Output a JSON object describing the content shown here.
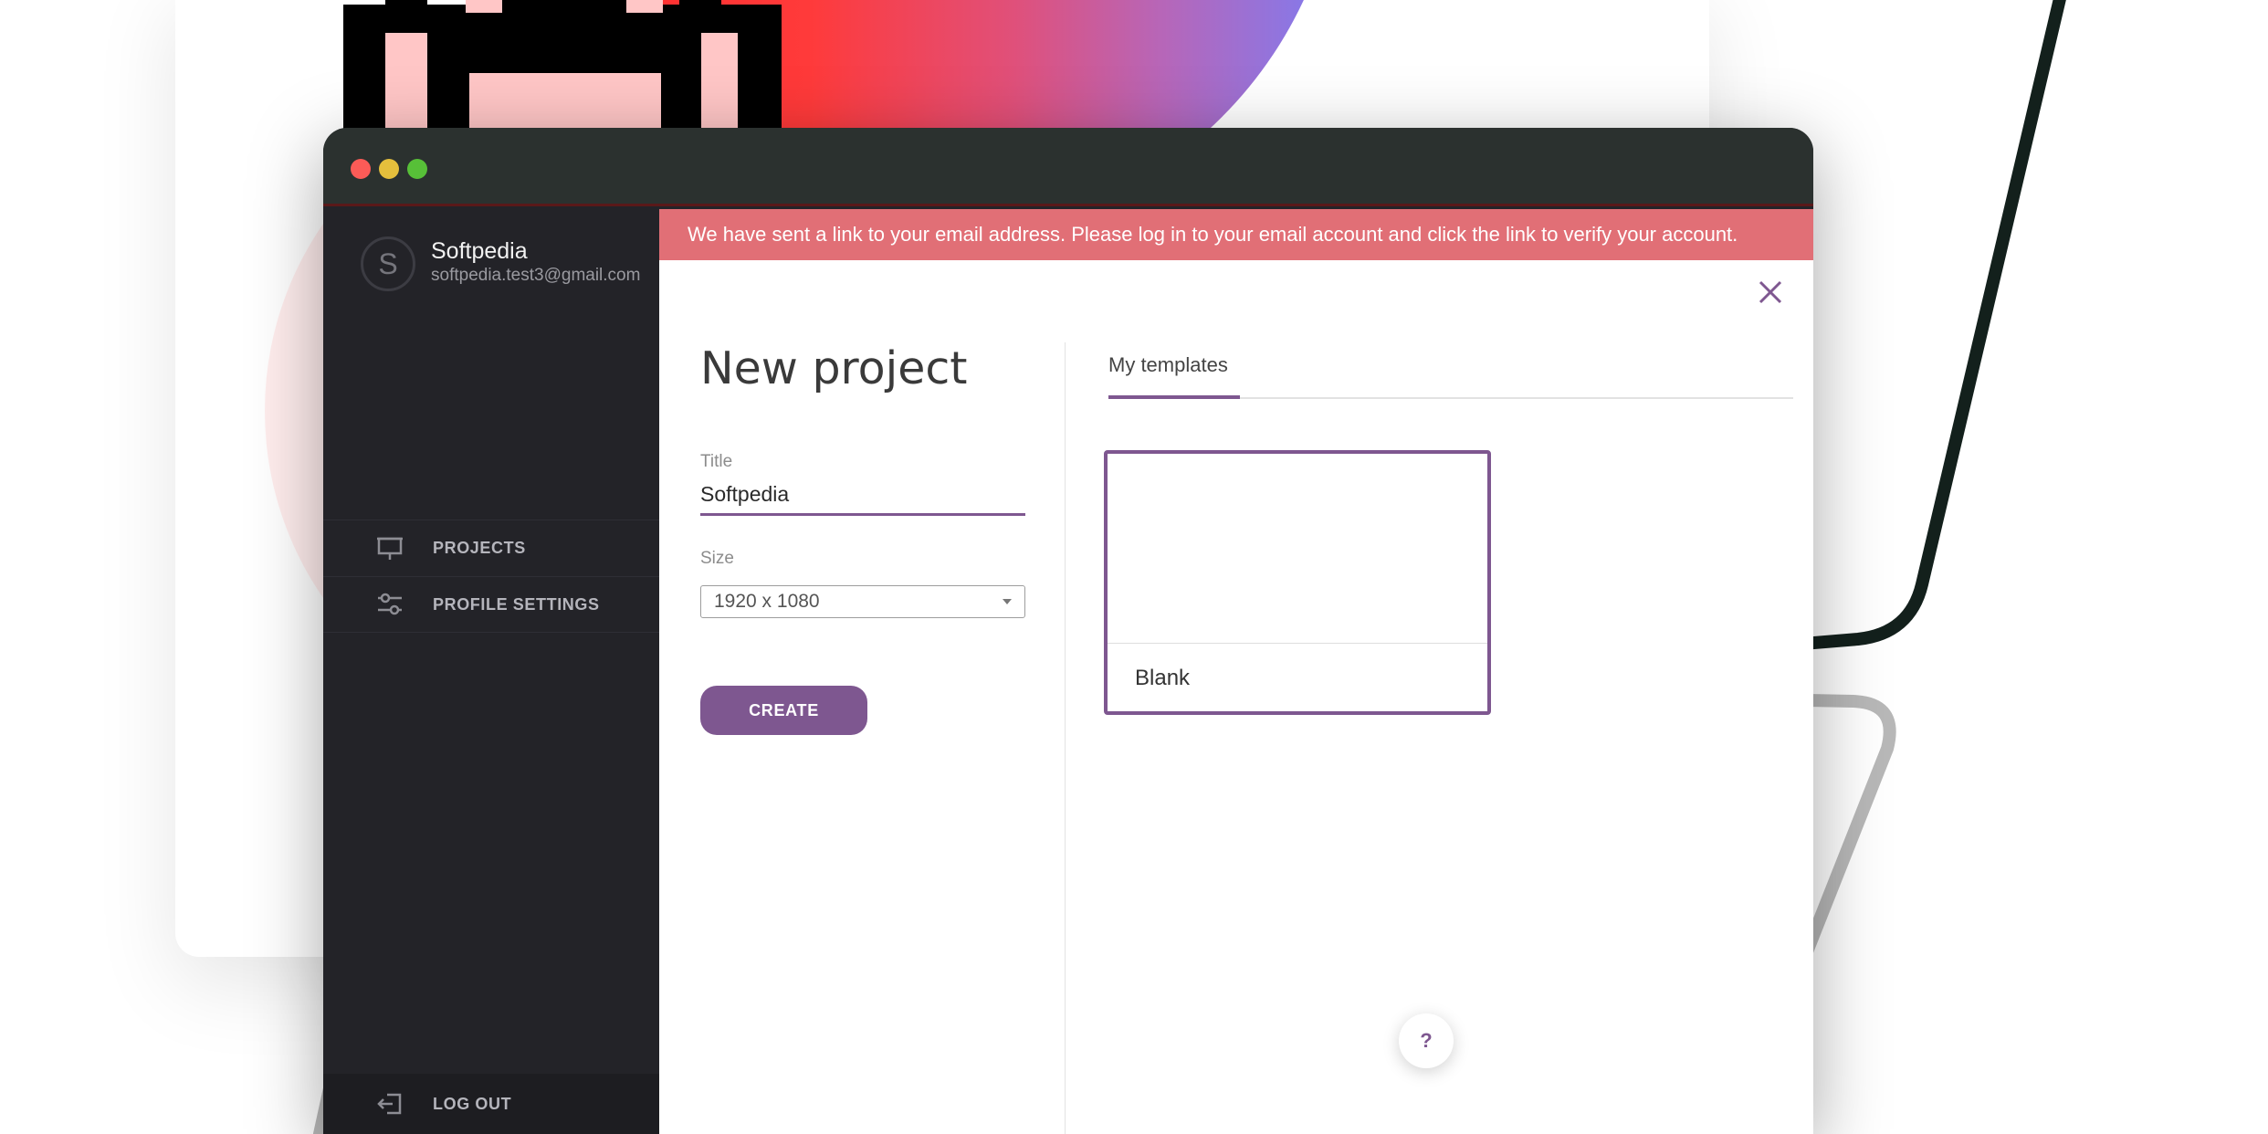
{
  "window": {
    "controls": [
      "close",
      "minimize",
      "maximize"
    ]
  },
  "sidebar": {
    "avatar_initial": "S",
    "user_name": "Softpedia",
    "user_email": "softpedia.test3@gmail.com",
    "items": [
      {
        "label": "PROJECTS",
        "icon": "presentation-icon"
      },
      {
        "label": "PROFILE SETTINGS",
        "icon": "sliders-icon"
      }
    ],
    "logout_label": "LOG OUT"
  },
  "banner": {
    "message": "We have sent a link to your email address. Please log in to your email account and click the link to verify your account."
  },
  "new_project": {
    "heading": "New project",
    "title_label": "Title",
    "title_value": "Softpedia",
    "size_label": "Size",
    "size_value": "1920 x 1080",
    "create_label": "CREATE"
  },
  "templates": {
    "tab_label": "My templates",
    "items": [
      {
        "label": "Blank"
      }
    ]
  },
  "help": {
    "label": "?"
  },
  "colors": {
    "accent": "#7e5790",
    "banner": "#e16f76",
    "sidebar": "#232328",
    "titlebar": "#2b312f"
  }
}
